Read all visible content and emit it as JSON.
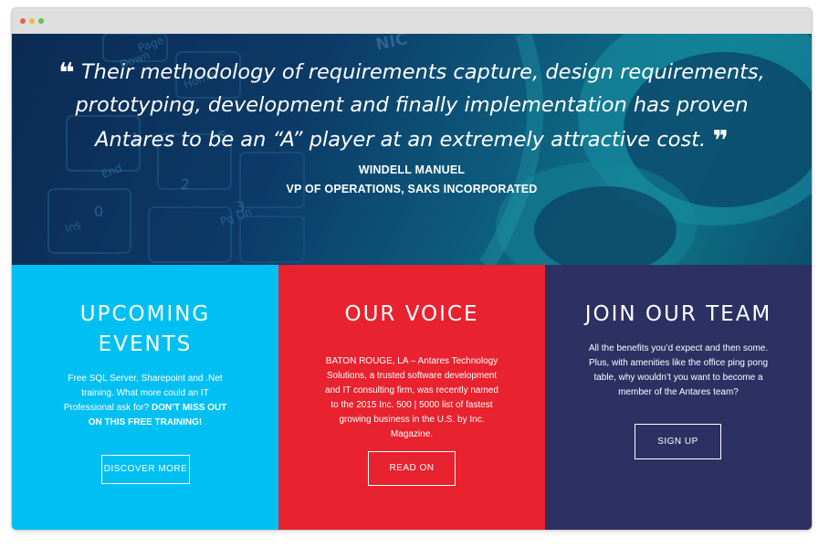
{
  "testimonial": {
    "open_mark": "❝",
    "quote": "Their methodology of requirements capture, design requirements, prototyping, development and finally implementation has proven Antares to be an “A” player at an extremely attractive cost.",
    "close_mark": "❞",
    "author_name": "WINDELL MANUEL",
    "author_title": "VP OF OPERATIONS, SAKS INCORPORATED"
  },
  "panels": {
    "events": {
      "title": "UPCOMING EVENTS",
      "body": "Free SQL Server, Sharepoint and .Net training. What more could an IT Professional ask for?",
      "body_bold": "DON’T MISS OUT ON THIS FREE TRAINING!",
      "button": "DISCOVER MORE",
      "color": "#00c0f3"
    },
    "voice": {
      "title": "OUR VOICE",
      "body": "BATON ROUGE, LA – Antares Technology Solutions, a trusted software development and IT consulting firm, was recently named to the 2015 Inc. 500 | 5000 list of fastest growing business in the U.S. by Inc. Magazine.",
      "button": "READ ON",
      "color": "#e8222f"
    },
    "team": {
      "title": "JOIN OUR TEAM",
      "body": "All the benefits you’d expect and then some. Plus, with amenities like the office ping pong table, why wouldn’t you want to become a member of the Antares team?",
      "button": "SIGN UP",
      "color": "#2c3062"
    }
  },
  "background_keyboard_labels": [
    "Page",
    "Down",
    "Home",
    "End",
    "Ins",
    "Pg Dn",
    "5",
    "2",
    "3",
    "0",
    "1",
    "NIC"
  ]
}
